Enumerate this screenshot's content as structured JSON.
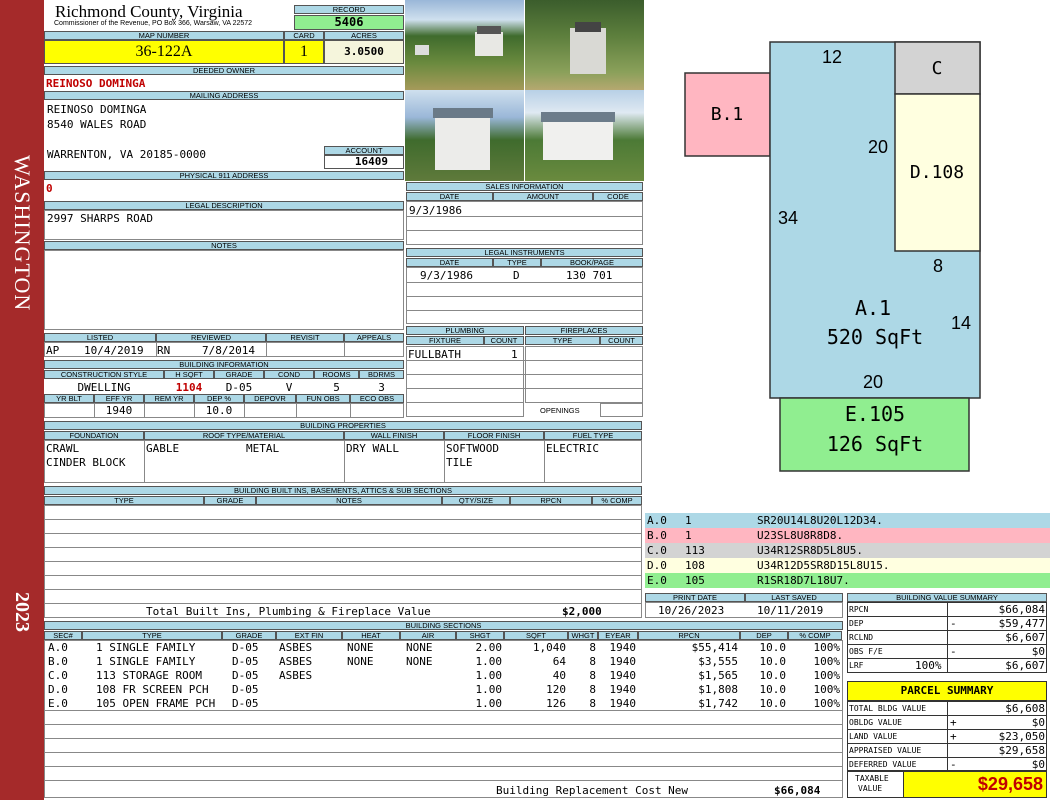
{
  "sidebar": {
    "owner_label": "WASHINGTON",
    "year": "2023"
  },
  "county": {
    "title": "Richmond County, Virginia",
    "subtitle": "Commissioner of the Revenue, PO Box 366, Warsaw, VA 22572"
  },
  "record": {
    "label": "RECORD",
    "value": "5406"
  },
  "map": {
    "label": "MAP NUMBER",
    "value": "36-122A",
    "card_label": "CARD",
    "card": "1",
    "acres_label": "ACRES",
    "acres": "3.0500"
  },
  "owner": {
    "deeded_label": "DEEDED OWNER",
    "deeded": "REINOSO DOMINGA",
    "mailing_label": "MAILING ADDRESS",
    "mail1": "REINOSO DOMINGA",
    "mail2": "8540 WALES ROAD",
    "mail3": "WARRENTON, VA 20185-0000",
    "account_label": "ACCOUNT",
    "account": "16409",
    "physical_label": "PHYSICAL 911 ADDRESS",
    "physical": "0"
  },
  "legal": {
    "label": "LEGAL DESCRIPTION",
    "value": "2997 SHARPS ROAD"
  },
  "notes": {
    "label": "NOTES"
  },
  "sales": {
    "label": "SALES INFORMATION",
    "h_date": "DATE",
    "h_amount": "AMOUNT",
    "h_code": "CODE",
    "date": "9/3/1986"
  },
  "instruments": {
    "label": "LEGAL INSTRUMENTS",
    "h_date": "DATE",
    "h_type": "TYPE",
    "h_book": "BOOK/PAGE",
    "date": "9/3/1986",
    "type": "D",
    "book": "130 701"
  },
  "status": {
    "listed_label": "LISTED",
    "reviewed_label": "REVIEWED",
    "revisit_label": "REVISIT",
    "appeals_label": "APPEALS",
    "listed_by": "AP",
    "listed": "10/4/2019",
    "reviewed_by": "RN",
    "reviewed": "7/8/2014"
  },
  "building_info": {
    "label": "BUILDING INFORMATION",
    "h_style": "CONSTRUCTION STYLE",
    "h_hsqft": "H SQFT",
    "h_grade": "GRADE",
    "h_cond": "COND",
    "h_rooms": "ROOMS",
    "h_bdrms": "BDRMS",
    "style": "DWELLING",
    "hsqft": "1104",
    "grade": "D-05",
    "cond": "V",
    "rooms": "5",
    "bdrms": "3",
    "h_yrblt": "YR BLT",
    "h_effyr": "EFF YR",
    "h_remyr": "REM YR",
    "h_dep": "DEP %",
    "h_depovr": "DEPOVR",
    "h_funobs": "FUN OBS",
    "h_ecoobs": "ECO OBS",
    "effyr": "1940",
    "dep": "10.0"
  },
  "plumbing": {
    "label": "PLUMBING",
    "h_fixture": "FIXTURE",
    "h_count": "COUNT",
    "fixture": "FULLBATH",
    "count": "1"
  },
  "fireplaces": {
    "label": "FIREPLACES",
    "h_type": "TYPE",
    "h_count": "COUNT",
    "openings": "OPENINGS"
  },
  "props": {
    "label": "BUILDING PROPERTIES",
    "h_foundation": "FOUNDATION",
    "h_roof": "ROOF TYPE/MATERIAL",
    "h_wall": "WALL FINISH",
    "h_floor": "FLOOR FINISH",
    "h_fuel": "FUEL TYPE",
    "foundation1": "CRAWL",
    "foundation2": "CINDER BLOCK",
    "roof1": "GABLE",
    "roof2": "METAL",
    "wall": "DRY WALL",
    "floor1": "SOFTWOOD",
    "floor2": "TILE",
    "fuel": "ELECTRIC"
  },
  "builtins": {
    "label": "BUILDING BUILT INS, BASEMENTS, ATTICS & SUB SECTIONS",
    "h_type": "TYPE",
    "h_grade": "GRADE",
    "h_notes": "NOTES",
    "h_qty": "QTY/SIZE",
    "h_rpcn": "RPCN",
    "h_comp": "% COMP",
    "total_label": "Total Built Ins, Plumbing & Fireplace Value",
    "total": "$2,000"
  },
  "sketch": {
    "a_label": "A.1",
    "a_sqft": "520 SqFt",
    "b_label": "B.1",
    "c_label": "C",
    "d_label": "D.108",
    "e_label": "E.105",
    "e_sqft": "126 SqFt",
    "dim_12": "12",
    "dim_20a": "20",
    "dim_34": "34",
    "dim_8": "8",
    "dim_14": "14",
    "dim_20b": "20"
  },
  "legend": [
    {
      "code": "A.0",
      "num": "1",
      "desc": "SR20U14L8U20L12D34.",
      "color": "#add8e6"
    },
    {
      "code": "B.0",
      "num": "1",
      "desc": "U23SL8U8R8D8.",
      "color": "#ffb6c1"
    },
    {
      "code": "C.0",
      "num": "113",
      "desc": "U34R12SR8D5L8U5.",
      "color": "#d3d3d3"
    },
    {
      "code": "D.0",
      "num": "108",
      "desc": "U34R12D5SR8D15L8U15.",
      "color": "#ffffe0"
    },
    {
      "code": "E.0",
      "num": "105",
      "desc": "R1SR18D7L18U7.",
      "color": "#90ee90"
    }
  ],
  "dates": {
    "print_label": "PRINT DATE",
    "print": "10/26/2023",
    "saved_label": "LAST SAVED",
    "saved": "10/11/2019"
  },
  "sections": {
    "label": "BUILDING SECTIONS",
    "headers": [
      "SEC#",
      "TYPE",
      "GRADE",
      "EXT FIN",
      "HEAT",
      "AIR",
      "SHGT",
      "SQFT",
      "WHGT",
      "EYEAR",
      "RPCN",
      "DEP",
      "% COMP"
    ],
    "rows": [
      {
        "sec": "A.0",
        "type": "1 SINGLE FAMILY",
        "grade": "D-05",
        "ext": "ASBES",
        "heat": "NONE",
        "air": "NONE",
        "shgt": "2.00",
        "sqft": "1,040",
        "whgt": "8",
        "eyear": "1940",
        "rpcn": "$55,414",
        "dep": "10.0",
        "comp": "100%"
      },
      {
        "sec": "B.0",
        "type": "1 SINGLE FAMILY",
        "grade": "D-05",
        "ext": "ASBES",
        "heat": "NONE",
        "air": "NONE",
        "shgt": "1.00",
        "sqft": "64",
        "whgt": "8",
        "eyear": "1940",
        "rpcn": "$3,555",
        "dep": "10.0",
        "comp": "100%"
      },
      {
        "sec": "C.0",
        "type": "113 STORAGE ROOM",
        "grade": "D-05",
        "ext": "ASBES",
        "heat": "",
        "air": "",
        "shgt": "1.00",
        "sqft": "40",
        "whgt": "8",
        "eyear": "1940",
        "rpcn": "$1,565",
        "dep": "10.0",
        "comp": "100%"
      },
      {
        "sec": "D.0",
        "type": "108 FR SCREEN PCH",
        "grade": "D-05",
        "ext": "",
        "heat": "",
        "air": "",
        "shgt": "1.00",
        "sqft": "120",
        "whgt": "8",
        "eyear": "1940",
        "rpcn": "$1,808",
        "dep": "10.0",
        "comp": "100%"
      },
      {
        "sec": "E.0",
        "type": "105 OPEN FRAME PCH",
        "grade": "D-05",
        "ext": "",
        "heat": "",
        "air": "",
        "shgt": "1.00",
        "sqft": "126",
        "whgt": "8",
        "eyear": "1940",
        "rpcn": "$1,742",
        "dep": "10.0",
        "comp": "100%"
      }
    ],
    "total_label": "Building Replacement Cost New",
    "total": "$66,084"
  },
  "value_summary": {
    "label": "BUILDING VALUE SUMMARY",
    "rpcn_l": "RPCN",
    "rpcn": "$66,084",
    "dep_l": "DEP",
    "dep_sign": "-",
    "dep": "$59,477",
    "rclnd_l": "RCLND",
    "rclnd": "$6,607",
    "obs_l": "OBS F/E",
    "obs_sign": "-",
    "obs": "$0",
    "lrf_l": "LRF",
    "lrf_pct": "100%",
    "lrf": "$6,607"
  },
  "parcel": {
    "label": "PARCEL SUMMARY",
    "bldg_l": "TOTAL BLDG VALUE",
    "bldg": "$6,608",
    "obldg_l": "OBLDG VALUE",
    "obldg_sign": "+",
    "obldg": "$0",
    "land_l": "LAND VALUE",
    "land_sign": "+",
    "land": "$23,050",
    "appr_l": "APPRAISED VALUE",
    "appr": "$29,658",
    "def_l": "DEFERRED VALUE",
    "def_sign": "-",
    "def": "$0",
    "taxable_l1": "TAXABLE",
    "taxable_l2": "VALUE",
    "taxable": "$29,658"
  }
}
